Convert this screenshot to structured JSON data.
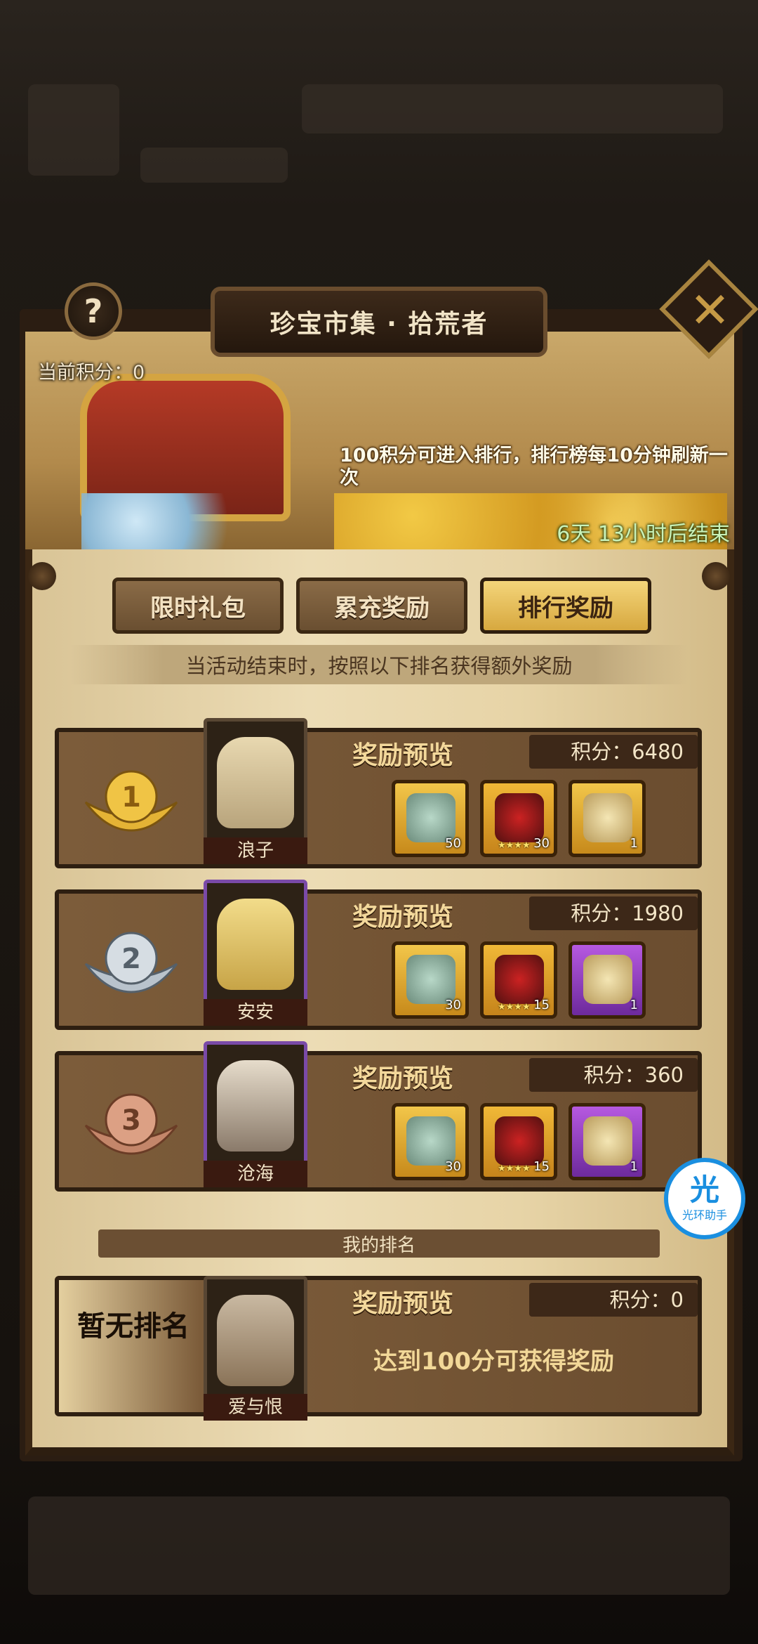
{
  "header": {
    "title": "珍宝市集 · 拾荒者",
    "help_icon": "question-icon",
    "close_icon": "close-icon"
  },
  "banner": {
    "current_score": "当前积分：0",
    "note": "100积分可进入排行，排行榜每10分钟刷新一次",
    "timer": "6天  13小时后结束"
  },
  "tabs": [
    {
      "label": "限时礼包",
      "active": false
    },
    {
      "label": "累充奖励",
      "active": false
    },
    {
      "label": "排行奖励",
      "active": true
    }
  ],
  "subtitle": "当活动结束时，按照以下排名获得额外奖励",
  "ranks": [
    {
      "rank": "1",
      "hero_name": "浪子",
      "reward_label": "奖励预览",
      "points": "积分：6480",
      "items": [
        {
          "icon": "coin-medal-icon",
          "count": "50"
        },
        {
          "icon": "hero-shard-icon",
          "stars": "★★★★",
          "count": "30"
        },
        {
          "icon": "treasure-chest-icon",
          "count": "1"
        }
      ]
    },
    {
      "rank": "2",
      "hero_name": "安安",
      "reward_label": "奖励预览",
      "points": "积分：1980",
      "items": [
        {
          "icon": "coin-medal-icon",
          "count": "30"
        },
        {
          "icon": "hero-shard-icon",
          "stars": "★★★★",
          "count": "15"
        },
        {
          "icon": "treasure-chest-icon",
          "count": "1"
        }
      ]
    },
    {
      "rank": "3",
      "hero_name": "沧海",
      "reward_label": "奖励预览",
      "points": "积分：360",
      "items": [
        {
          "icon": "coin-medal-icon",
          "count": "30"
        },
        {
          "icon": "hero-shard-icon",
          "stars": "★★★★",
          "count": "15"
        },
        {
          "icon": "treasure-chest-icon",
          "count": "1"
        }
      ]
    }
  ],
  "my_rank": {
    "bar_label": "我的排名",
    "status": "暂无排名",
    "hero_name": "爱与恨",
    "reward_label": "奖励预览",
    "points": "积分：0",
    "tip": "达到100分可获得奖励"
  },
  "overlay_badge": {
    "glyph": "光",
    "label": "光环助手"
  },
  "colors": {
    "active_tab": "#e8bf5a",
    "timer_text": "#c9f2b9",
    "purple_item": "#8c3cc0"
  }
}
